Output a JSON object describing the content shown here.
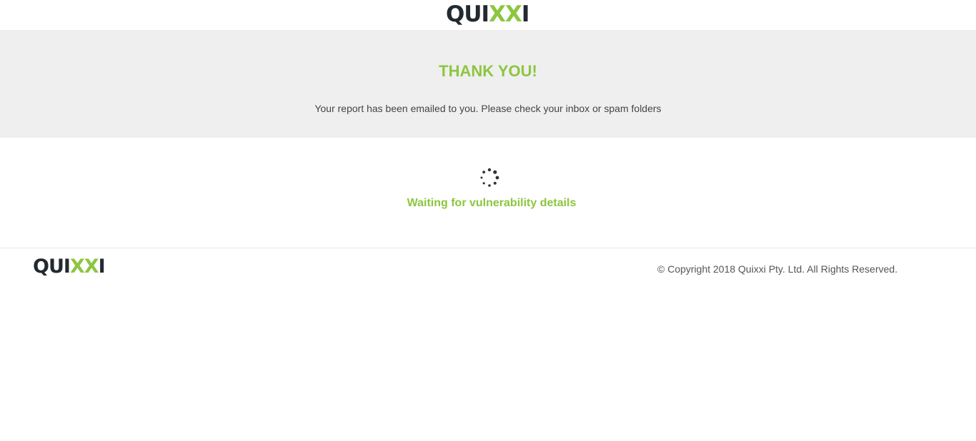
{
  "header": {
    "logo": {
      "part1": "QUI",
      "part2": "XX",
      "part3": "I",
      "brand_color": "#8dc63f",
      "dark_color": "#222a30"
    }
  },
  "hero": {
    "title": "THANK YOU!",
    "message": "Your report has been emailed to you. Please check your inbox or spam folders"
  },
  "status": {
    "spinner_icon": "loading-spinner-icon",
    "text": "Waiting for vulnerability details"
  },
  "footer": {
    "logo": {
      "part1": "QUI",
      "part2": "XX",
      "part3": "I"
    },
    "copyright": "© Copyright 2018 Quixxi Pty. Ltd. All Rights Reserved."
  },
  "colors": {
    "accent": "#8dc63f",
    "hero_bg": "#efefef"
  }
}
